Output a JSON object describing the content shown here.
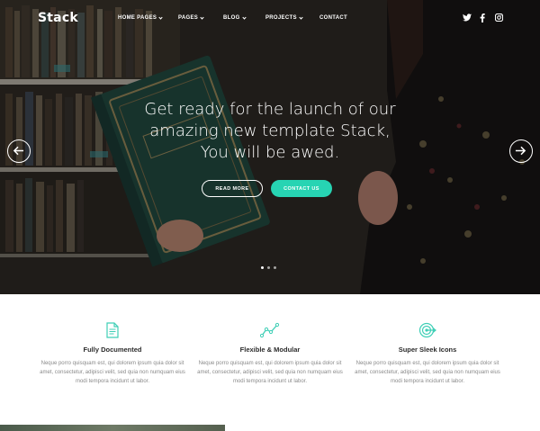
{
  "brand": {
    "logo": "Stack"
  },
  "nav": {
    "items": [
      {
        "label": "HOME PAGES",
        "dropdown": true
      },
      {
        "label": "PAGES",
        "dropdown": true
      },
      {
        "label": "BLOG",
        "dropdown": true
      },
      {
        "label": "PROJECTS",
        "dropdown": true
      },
      {
        "label": "CONTACT",
        "dropdown": false
      }
    ],
    "social": [
      "twitter-icon",
      "facebook-icon",
      "instagram-icon"
    ]
  },
  "hero": {
    "headline": "Get ready for the launch of our amazing new template Stack, You will be awed.",
    "primary_button": "READ MORE",
    "secondary_button": "CONTACT US",
    "slides_total": 3,
    "slide_active": 1
  },
  "features": [
    {
      "icon": "document-icon",
      "title": "Fully Documented",
      "text": "Neque porro quisquam est, qui dolorem ipsum quia dolor sit amet, consectetur, adipisci velit, sed quia non numquam eius modi tempora incidunt ut labor."
    },
    {
      "icon": "chart-line-icon",
      "title": "Flexible & Modular",
      "text": "Neque porro quisquam est, qui dolorem ipsum quia dolor sit amet, consectetur, adipisci velit, sed quia non numquam eius modi tempora incidunt ut labor."
    },
    {
      "icon": "target-icon",
      "title": "Super Sleek Icons",
      "text": "Neque porro quisquam est, qui dolorem ipsum quia dolor sit amet, consectetur, adipisci velit, sed quia non numquam eius modi tempora incidunt ut labor."
    }
  ],
  "colors": {
    "accent": "#27d4b3",
    "icon": "#3fcfb6"
  }
}
